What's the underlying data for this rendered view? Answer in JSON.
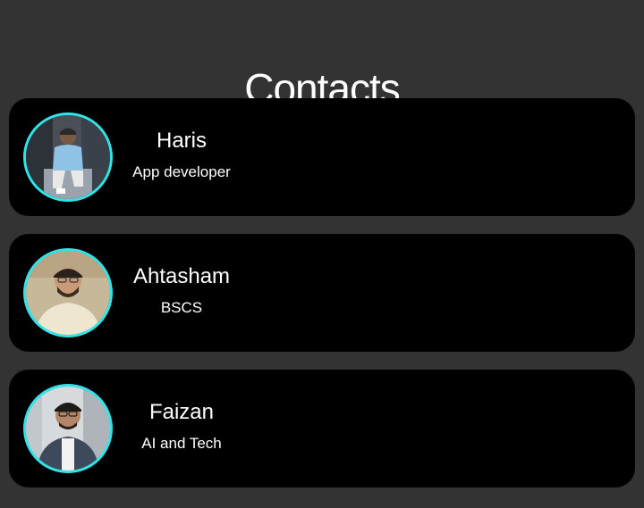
{
  "header": {
    "title": "Contacts"
  },
  "contacts": [
    {
      "name": "Haris",
      "role": "App developer",
      "avatar_icon": "person-photo"
    },
    {
      "name": "Ahtasham",
      "role": "BSCS",
      "avatar_icon": "person-photo"
    },
    {
      "name": "Faizan",
      "role": "AI and Tech",
      "avatar_icon": "person-photo"
    }
  ],
  "colors": {
    "background": "#333333",
    "card": "#000000",
    "avatar_ring": "#2ee6ea",
    "text": "#ffffff"
  }
}
